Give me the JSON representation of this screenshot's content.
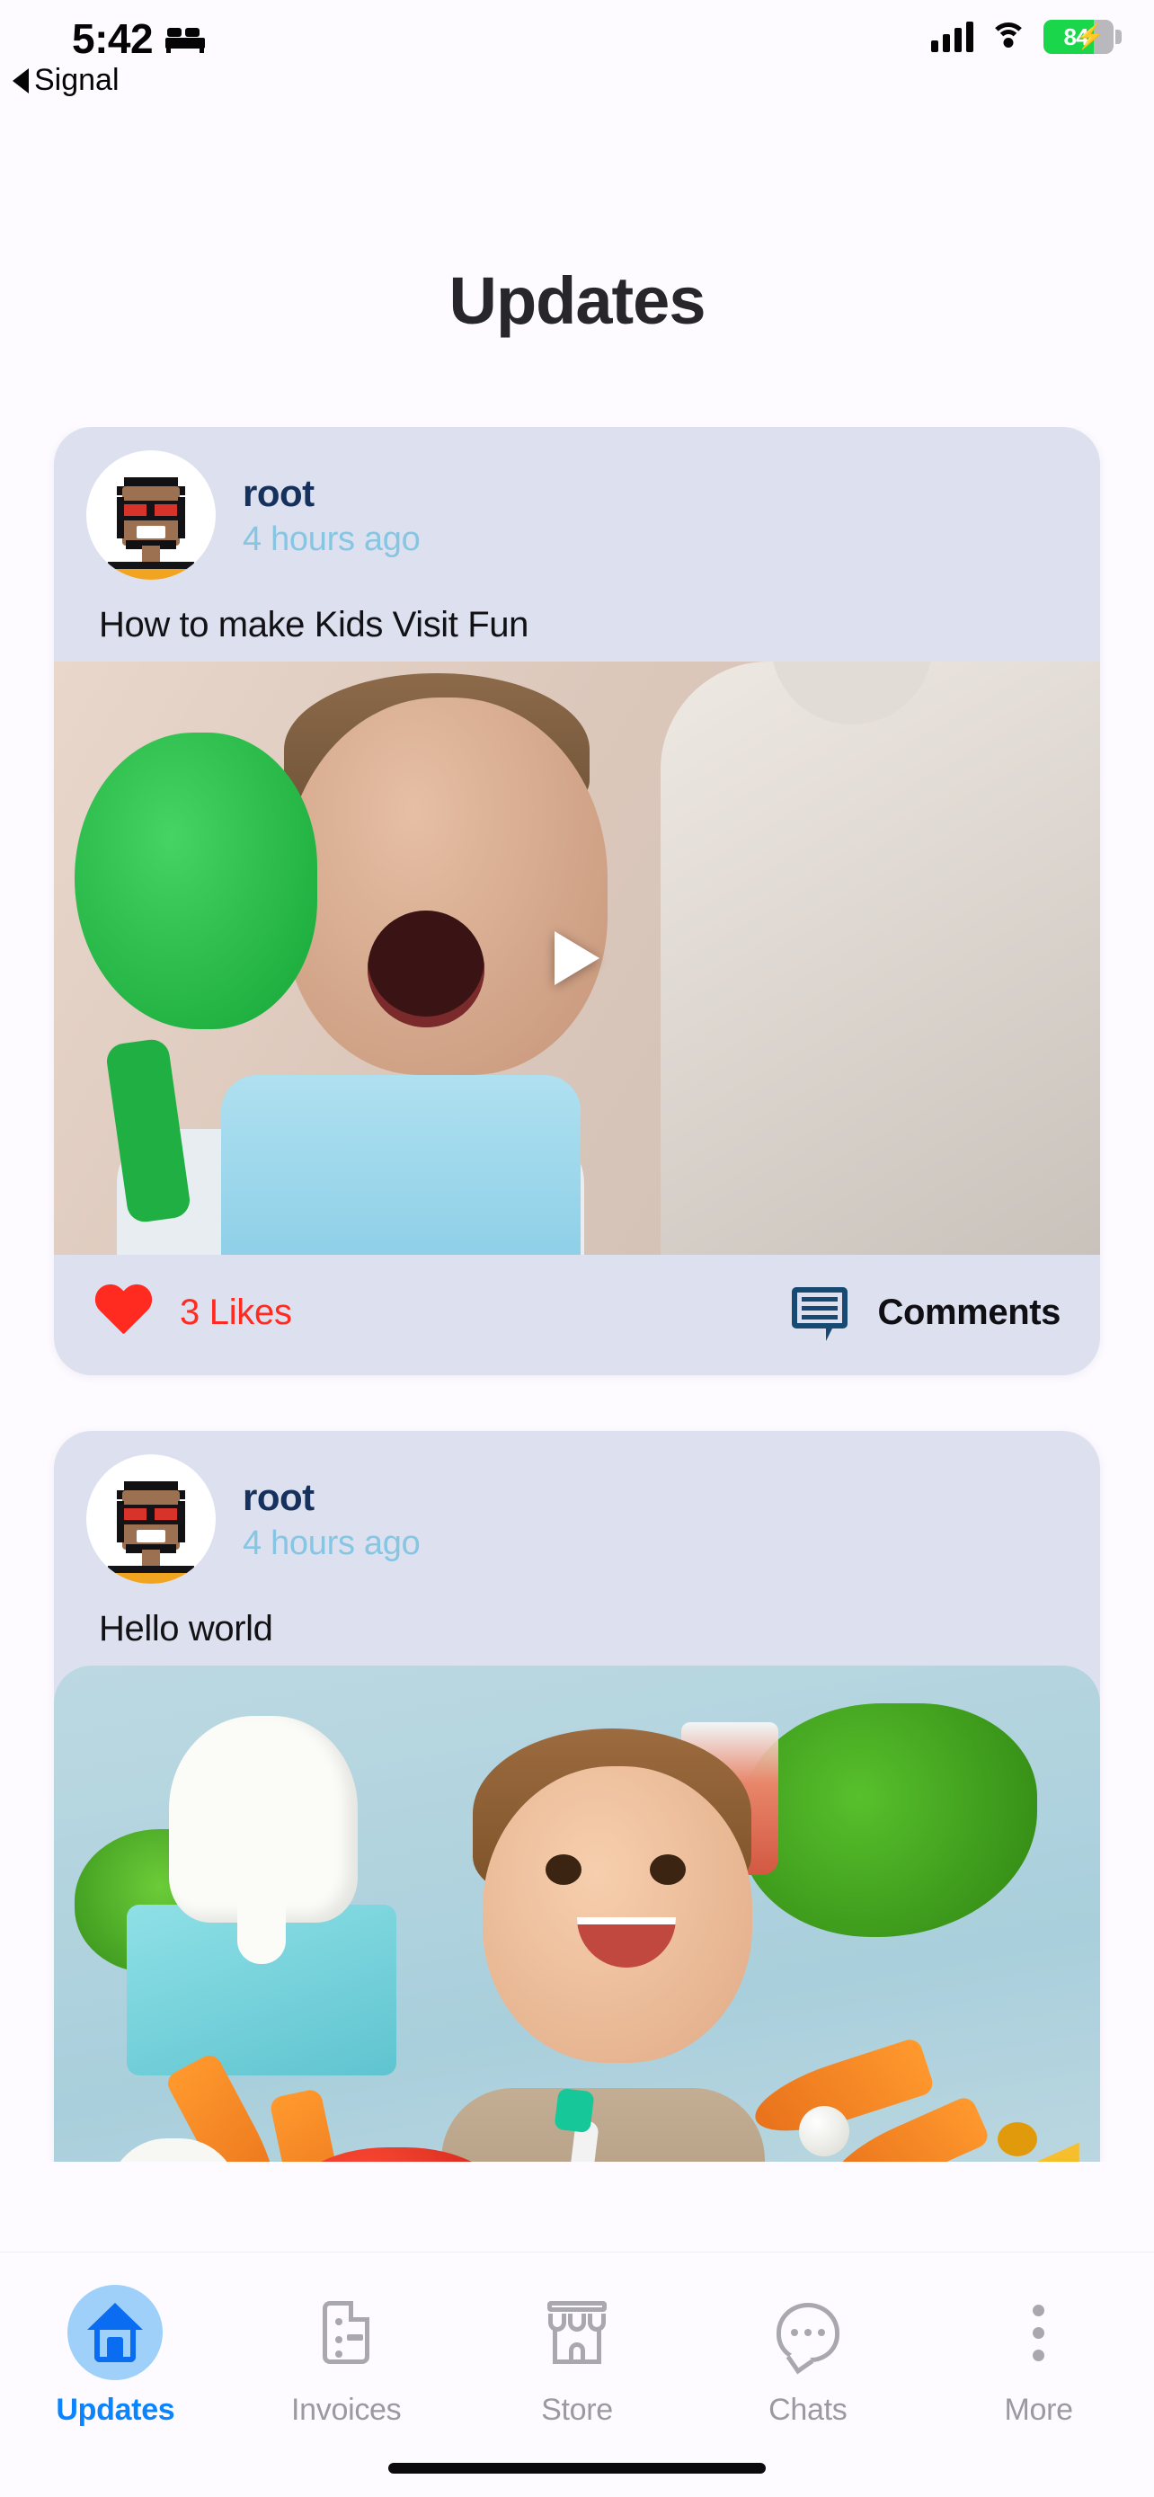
{
  "status_bar": {
    "time": "5:42",
    "focus_icon": "bed-icon",
    "back_label": "Signal",
    "cellular_icon": "cellular-bars-icon",
    "wifi_icon": "wifi-icon",
    "battery_percent": "84",
    "battery_charging": true,
    "battery_fill_color": "#19D64A"
  },
  "header": {
    "title": "Updates"
  },
  "feed": {
    "posts": [
      {
        "username": "root",
        "timestamp": "4 hours ago",
        "avatar": "pixel-avatar",
        "text": "How to make Kids Visit Fun",
        "media_type": "video",
        "media_alt": "Child in dentist chair holding green mirror with mouth open",
        "play_icon": "play-icon",
        "likes_count": "3",
        "likes_label": "3 Likes",
        "likes_color": "#FF2A20",
        "comments_label": "Comments",
        "comments_icon": "comment-bubble-icon"
      },
      {
        "username": "root",
        "timestamp": "4 hours ago",
        "avatar": "pixel-avatar",
        "text": "Hello world",
        "media_type": "image",
        "media_alt": "Smiling toddler with toothbrush surrounded by tooth model, carrots, tomatoes and cheese"
      }
    ]
  },
  "tabbar": {
    "items": [
      {
        "label": "Updates",
        "icon": "home-icon",
        "active": true
      },
      {
        "label": "Invoices",
        "icon": "document-icon",
        "active": false
      },
      {
        "label": "Store",
        "icon": "store-icon",
        "active": false
      },
      {
        "label": "Chats",
        "icon": "chat-icon",
        "active": false
      },
      {
        "label": "More",
        "icon": "more-dots-icon",
        "active": false
      }
    ],
    "active_color": "#0A84FF",
    "inactive_color": "#9A9AA0"
  },
  "colors": {
    "page_background": "#FDFBFF",
    "card_background": "#DDE0EE",
    "username": "#16325C",
    "timestamp": "#86C6E3",
    "title": "#26262B"
  }
}
